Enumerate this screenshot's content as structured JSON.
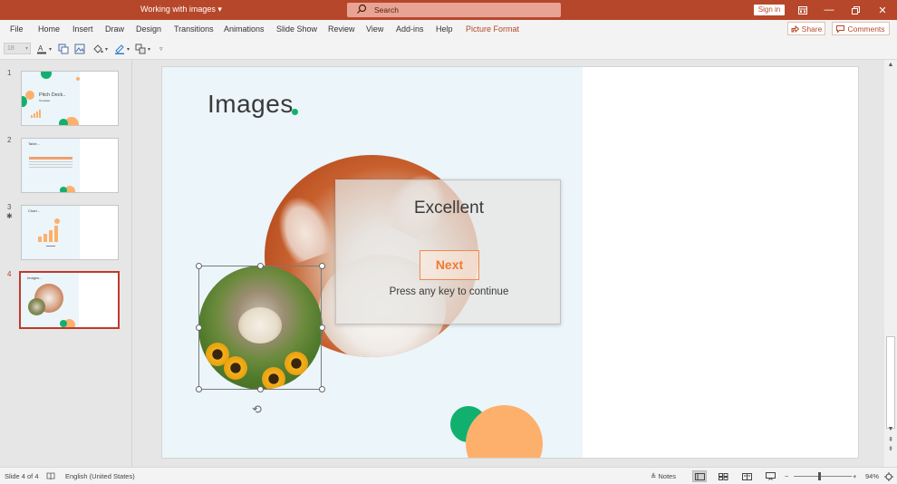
{
  "titlebar": {
    "doc_title": "Working with images",
    "search_placeholder": "Search",
    "signin": "Sign in"
  },
  "menu": {
    "items": [
      "File",
      "Home",
      "Insert",
      "Draw",
      "Design",
      "Transitions",
      "Animations",
      "Slide Show",
      "Review",
      "View",
      "Add-ins",
      "Help",
      "Picture Format"
    ],
    "active": "Picture Format",
    "share": "Share",
    "comments": "Comments"
  },
  "toolbar": {
    "font_size": "18"
  },
  "slides_panel": {
    "thumbs": [
      {
        "num": "1",
        "label": "Pitch Deck..",
        "sub": "Template"
      },
      {
        "num": "2",
        "label": "Table..."
      },
      {
        "num": "3",
        "label": "Chart...",
        "starred": true
      },
      {
        "num": "4",
        "label": "Images...",
        "selected": true
      }
    ]
  },
  "slide": {
    "title": "Images",
    "dialog": {
      "title": "Excellent",
      "button": "Next",
      "message": "Press any key to continue"
    }
  },
  "status": {
    "slide_info": "Slide 4 of 4",
    "language": "English (United States)",
    "notes": "Notes",
    "zoom_minus": "−",
    "zoom_plus": "+",
    "zoom": "94%"
  },
  "colors": {
    "ribbon": "#b7472a",
    "green": "#11b06f",
    "orange": "#fdb06c",
    "accent_text": "#ee7b35"
  }
}
